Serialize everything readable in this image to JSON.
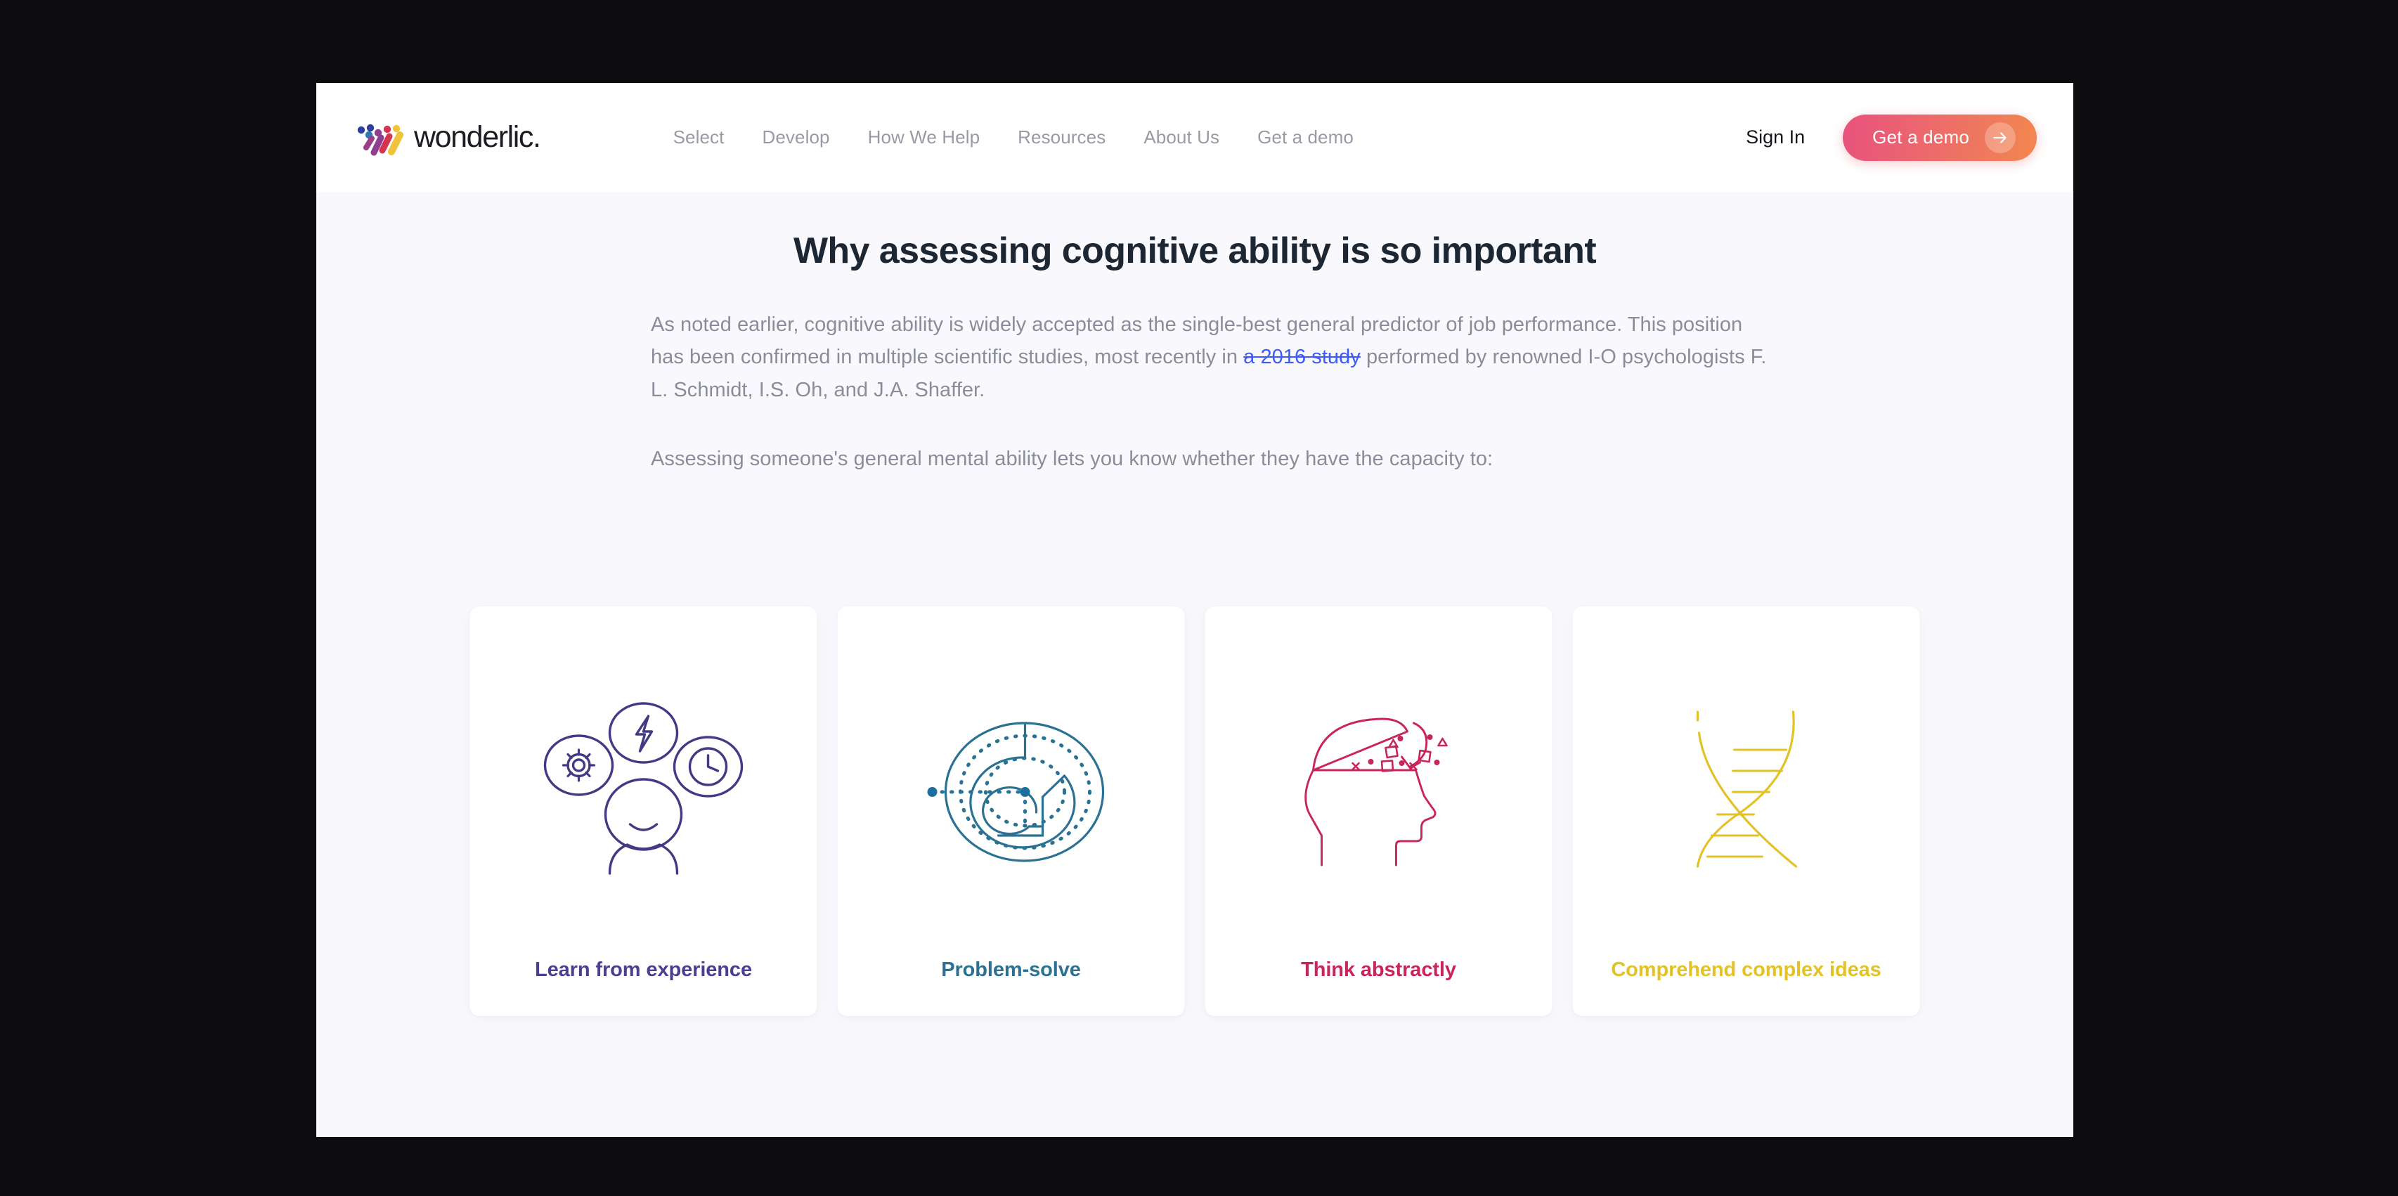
{
  "header": {
    "brand_word": "wonderlic.",
    "brand_mark_icon": "wonderlic-logo-mark",
    "nav": [
      {
        "label": "Select"
      },
      {
        "label": "Develop"
      },
      {
        "label": "How We Help"
      },
      {
        "label": "Resources"
      },
      {
        "label": "About Us"
      },
      {
        "label": "Get a demo"
      }
    ],
    "signin_label": "Sign In",
    "cta_label": "Get a demo",
    "cta_arrow_icon": "arrow-right-icon"
  },
  "main": {
    "title": "Why assessing cognitive ability is so important",
    "paragraph_1_before_link": "As noted earlier, cognitive ability is widely accepted as the single-best general predictor of job performance. This position has been confirmed in multiple scientific studies, most recently in ",
    "paragraph_1_link": "a 2016 study",
    "paragraph_1_after_link": " performed by renowned I-O psychologists F. L. Schmidt, I.S. Oh, and J.A. Shaffer.",
    "paragraph_2": "Assessing someone's general mental ability lets you know whether they have the capacity to:",
    "cards": [
      {
        "label": "Learn from experience",
        "icon": "person-with-gear-bolt-clock-icon",
        "color": "#4b3f8f"
      },
      {
        "label": "Problem-solve",
        "icon": "circular-maze-icon",
        "color": "#2b7193"
      },
      {
        "label": "Think abstractly",
        "icon": "head-profile-with-shapes-icon",
        "color": "#c8255c"
      },
      {
        "label": "Comprehend complex ideas",
        "icon": "dna-helix-icon",
        "color": "#e2c226"
      }
    ]
  },
  "colors": {
    "page_backdrop": "#0d0d0f",
    "header_bg": "#ffffff",
    "section_bg": "#f9f9fd",
    "card_bg": "#ffffff",
    "title": "#1d2733",
    "body_text": "#8a8d98",
    "link": "#3d5afe",
    "nav_text": "#9a9aa6",
    "cta_gradient_start": "#e8527c",
    "cta_gradient_end": "#f2874f"
  }
}
